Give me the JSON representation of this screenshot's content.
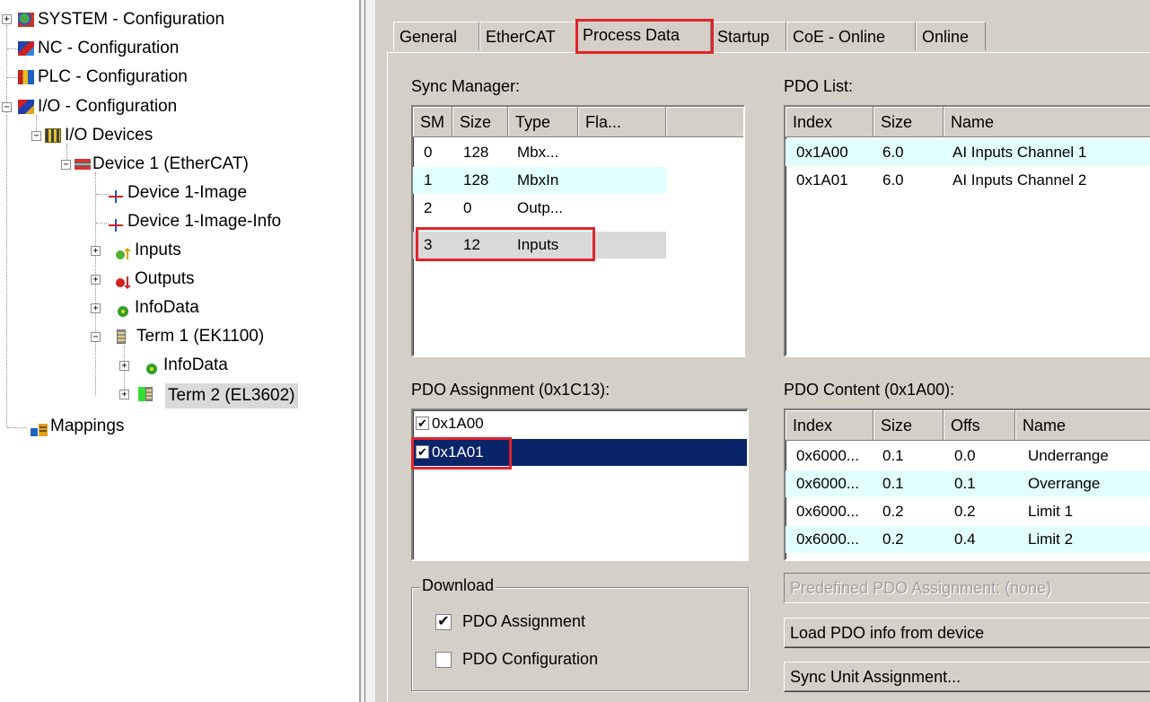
{
  "tree": {
    "items": [
      {
        "label": "SYSTEM - Configuration",
        "icon": "system-config-icon"
      },
      {
        "label": "NC - Configuration",
        "icon": "nc-config-icon"
      },
      {
        "label": "PLC - Configuration",
        "icon": "plc-config-icon"
      },
      {
        "label": "I/O - Configuration",
        "icon": "io-config-icon"
      },
      {
        "label": "I/O Devices",
        "icon": "io-devices-icon"
      },
      {
        "label": "Device 1 (EtherCAT)",
        "icon": "ethercat-device-icon"
      },
      {
        "label": "Device 1-Image",
        "icon": "image-icon"
      },
      {
        "label": "Device 1-Image-Info",
        "icon": "image-info-icon"
      },
      {
        "label": "Inputs",
        "icon": "inputs-icon"
      },
      {
        "label": "Outputs",
        "icon": "outputs-icon"
      },
      {
        "label": "InfoData",
        "icon": "infodata-icon"
      },
      {
        "label": "Term 1 (EK1100)",
        "icon": "terminal-icon"
      },
      {
        "label": "InfoData",
        "icon": "infodata-icon"
      },
      {
        "label": "Term 2 (EL3602)",
        "icon": "terminal-icon"
      },
      {
        "label": "Mappings",
        "icon": "mappings-icon"
      }
    ],
    "selected": "Term 2 (EL3602)"
  },
  "tabs": [
    "General",
    "EtherCAT",
    "Process Data",
    "Startup",
    "CoE - Online",
    "Online"
  ],
  "active_tab": "Process Data",
  "sync_manager": {
    "label": "Sync Manager:",
    "columns": [
      "SM",
      "Size",
      "Type",
      "Fla..."
    ],
    "rows": [
      [
        "0",
        "128",
        "Mbx..."
      ],
      [
        "1",
        "128",
        "MbxIn"
      ],
      [
        "2",
        "0",
        "Outp..."
      ],
      [
        "3",
        "12",
        "Inputs"
      ]
    ]
  },
  "pdo_list": {
    "label": "PDO List:",
    "columns": [
      "Index",
      "Size",
      "Name"
    ],
    "rows": [
      [
        "0x1A00",
        "6.0",
        "AI Inputs Channel 1"
      ],
      [
        "0x1A01",
        "6.0",
        "AI Inputs Channel 2"
      ]
    ]
  },
  "pdo_assignment": {
    "label": "PDO Assignment (0x1C13):",
    "items": [
      {
        "label": "0x1A00",
        "checked": true
      },
      {
        "label": "0x1A01",
        "checked": true
      }
    ]
  },
  "pdo_content": {
    "label": "PDO Content (0x1A00):",
    "columns": [
      "Index",
      "Size",
      "Offs",
      "Name"
    ],
    "rows": [
      [
        "0x6000...",
        "0.1",
        "0.0",
        "Underrange"
      ],
      [
        "0x6000...",
        "0.1",
        "0.1",
        "Overrange"
      ],
      [
        "0x6000...",
        "0.2",
        "0.2",
        "Limit 1"
      ],
      [
        "0x6000...",
        "0.2",
        "0.4",
        "Limit 2"
      ]
    ]
  },
  "download": {
    "label": "Download",
    "pdo_assignment": {
      "label": "PDO Assignment",
      "checked": true
    },
    "pdo_configuration": {
      "label": "PDO Configuration",
      "checked": false
    }
  },
  "buttons": {
    "predefined": "Predefined PDO Assignment: (none)",
    "load_pdo": "Load PDO info from device",
    "sync_unit": "Sync Unit Assignment..."
  },
  "colors": {
    "highlight_red": "#e0242c",
    "selection_navy": "#0a246a",
    "alt_row": "#e2ffff",
    "dialog_bg": "#d4d0c8"
  }
}
